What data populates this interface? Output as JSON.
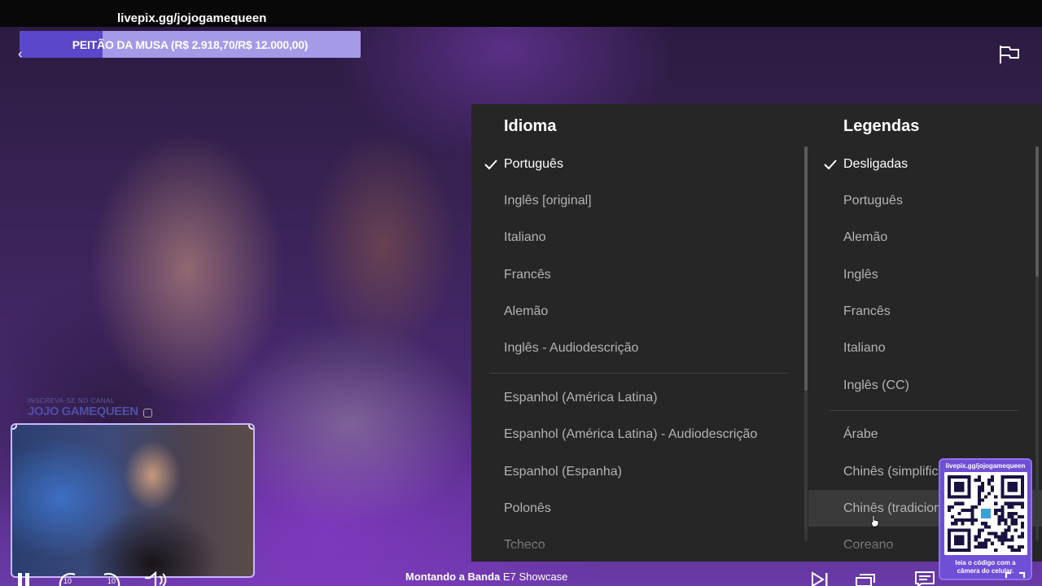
{
  "overlay": {
    "url": "livepix.gg/jojogamequeen",
    "goal_text": "PEITÃO DA MUSA (R$ 2.918,70/R$ 12.000,00)",
    "goal_progress": 0.243
  },
  "streamer": {
    "brand_small": "INSCREVA-SE NO CANAL",
    "brand_name": "JOJO GAMEQUEEN"
  },
  "audio_panel": {
    "title": "Idioma",
    "options": [
      {
        "label": "Português",
        "selected": true
      },
      {
        "label": "Inglês [original]",
        "selected": false
      },
      {
        "label": "Italiano",
        "selected": false
      },
      {
        "label": "Francês",
        "selected": false
      },
      {
        "label": "Alemão",
        "selected": false
      },
      {
        "label": "Inglês - Audiodescrição",
        "selected": false
      },
      {
        "label": "Espanhol (América Latina)",
        "selected": false
      },
      {
        "label": "Espanhol (América Latina) - Audiodescrição",
        "selected": false
      },
      {
        "label": "Espanhol (Espanha)",
        "selected": false
      },
      {
        "label": "Polonês",
        "selected": false
      },
      {
        "label": "Tcheco",
        "selected": false
      }
    ]
  },
  "subtitles_panel": {
    "title": "Legendas",
    "options": [
      {
        "label": "Desligadas",
        "selected": true
      },
      {
        "label": "Português",
        "selected": false
      },
      {
        "label": "Alemão",
        "selected": false
      },
      {
        "label": "Inglês",
        "selected": false
      },
      {
        "label": "Francês",
        "selected": false
      },
      {
        "label": "Italiano",
        "selected": false
      },
      {
        "label": "Inglês (CC)",
        "selected": false
      },
      {
        "label": "Árabe",
        "selected": false
      },
      {
        "label": "Chinês (simplificado)",
        "selected": false
      },
      {
        "label": "Chinês (tradicional)",
        "selected": false,
        "hovered": true
      },
      {
        "label": "Coreano",
        "selected": false
      }
    ]
  },
  "qr_widget": {
    "url": "livepix.gg/jojogamequeen",
    "caption_line1": "leia o código com a",
    "caption_line2": "câmera do celular."
  },
  "player": {
    "episode_show": "Montando a Banda",
    "episode_number": "E7",
    "episode_title": "Showcase",
    "skip_back_label": "10",
    "skip_fwd_label": "10"
  },
  "colors": {
    "panel_bg": "#262626",
    "goal_fill": "#5b47c9",
    "goal_bg": "#a49ae8",
    "qr_bg": "#6f4fd6"
  },
  "icons": [
    "flag-icon",
    "check-icon",
    "next-episode-icon",
    "episodes-icon",
    "subtitles-icon",
    "fullscreen-icon",
    "play-pause-icon",
    "rewind-10-icon",
    "forward-10-icon",
    "volume-icon",
    "speed-icon"
  ]
}
